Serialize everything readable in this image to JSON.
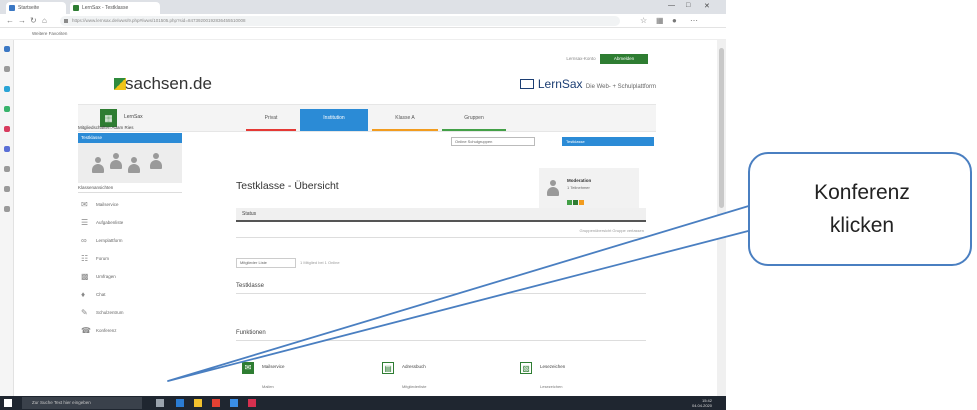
{
  "browser": {
    "tabs": [
      "Startseite",
      "LernSax - Testklasse"
    ],
    "url": "https://www.lernsax.de/wws/9.php#/wws/101505.php?sid=84739200192836455510008",
    "bookmarks": "Weitere Favoriten"
  },
  "header": {
    "logo": "sachsen.de",
    "lernsax_logo": "LernSax",
    "lernsax_tagline": "Die Web- + Schulplattform",
    "login_user": "Lernsax-Konto",
    "logout_button": "Abmelden"
  },
  "topnav": {
    "app_name": "LernSax",
    "tabs": [
      {
        "label": "Privat",
        "color": "#e53935"
      },
      {
        "label": "Institution",
        "color": "#2b8bd6"
      },
      {
        "label": "Klasse A",
        "color": "#f29c1f"
      },
      {
        "label": "Gruppen",
        "color": "#43a047"
      }
    ],
    "select_left": "Online Schulgruppen",
    "select_right": "Testklasse"
  },
  "sidebar": {
    "title": "Mitgliedschaften Adam Ries",
    "selected": "Testklasse",
    "subtitle": "Klassenansichten",
    "items": [
      {
        "icon": "mail",
        "label": "Mailservice"
      },
      {
        "icon": "tasks",
        "label": "Aufgabenliste"
      },
      {
        "icon": "chart",
        "label": "Lernplattform"
      },
      {
        "icon": "forum",
        "label": "Forum"
      },
      {
        "icon": "survey",
        "label": "Umfragen"
      },
      {
        "icon": "chat",
        "label": "Chat"
      },
      {
        "icon": "wiki",
        "label": "Schulzentrum"
      },
      {
        "icon": "conference",
        "label": "Konferenz"
      }
    ]
  },
  "main": {
    "title": "Testklasse - Übersicht",
    "user_name": "Moderation",
    "user_status": "1 Teilnehmer",
    "status_label": "Status",
    "status_right": "Gruppenübersicht   Gruppe verlassen",
    "members_select": "Mitglieder Liste",
    "members_info": "1 Mitglied bei 1 Online",
    "section1": "Testklasse",
    "section2": "Funktionen",
    "functions": [
      {
        "label": "Mailservice",
        "sub": "Mailen"
      },
      {
        "label": "Adressbuch",
        "sub": "Mitgliederliste"
      },
      {
        "label": "Lesezeichen",
        "sub": "Lesezeichen"
      }
    ]
  },
  "taskbar": {
    "search": "Zur Suche Text hier eingeben",
    "time": "15:42",
    "date": "04.04.2020"
  },
  "annotation": {
    "text_line1": "Konferenz",
    "text_line2": "klicken",
    "color": "#4a7fc1"
  }
}
